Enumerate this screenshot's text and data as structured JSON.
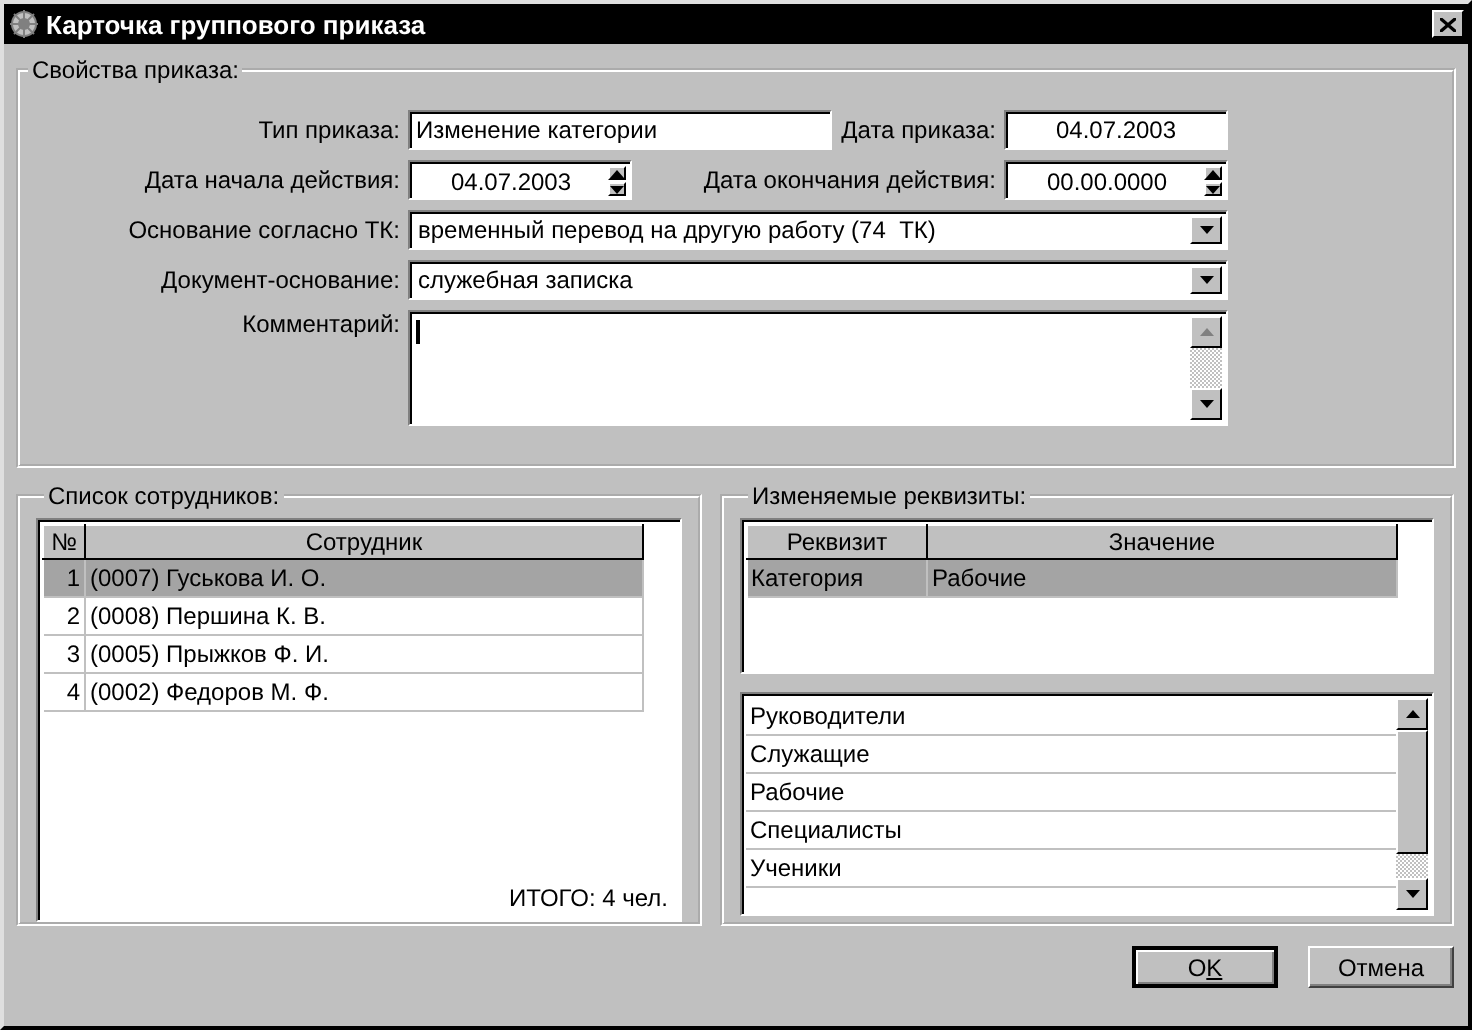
{
  "window": {
    "title": "Карточка группового приказа"
  },
  "order_properties": {
    "title": "Свойства приказа:",
    "order_type": {
      "label": "Тип приказа:",
      "value": "Изменение категории"
    },
    "order_date": {
      "label": "Дата приказа:",
      "value": "04.07.2003"
    },
    "start_date": {
      "label": "Дата начала действия:",
      "value": "04.07.2003"
    },
    "end_date": {
      "label": "Дата окончания действия:",
      "value": "00.00.0000"
    },
    "basis_tk": {
      "label": "Основание согласно ТК:",
      "value": "временный перевод на другую работу (74  ТК)"
    },
    "basis_document": {
      "label": "Документ-основание:",
      "value": "служебная записка"
    },
    "comment": {
      "label": "Комментарий:"
    }
  },
  "employees": {
    "title": "Список сотрудников:",
    "columns": [
      "№",
      "Сотрудник"
    ],
    "rows": [
      {
        "number": "1",
        "name": "(0007) Гуськова И. О.",
        "selected": true
      },
      {
        "number": "2",
        "name": "(0008) Першина К. В.",
        "selected": false
      },
      {
        "number": "3",
        "name": "(0005) Прыжков Ф. И.",
        "selected": false
      },
      {
        "number": "4",
        "name": "(0002) Федоров М. Ф.",
        "selected": false
      }
    ],
    "total": "ИТОГО: 4 чел."
  },
  "attributes": {
    "title": "Изменяемые реквизиты:",
    "columns": [
      "Реквизит",
      "Значение"
    ],
    "rows": [
      {
        "attribute": "Категория",
        "value": "Рабочие",
        "selected": true
      }
    ],
    "options": [
      {
        "label": "Руководители",
        "selected": false
      },
      {
        "label": "Служащие",
        "selected": false
      },
      {
        "label": "Рабочие",
        "selected": false
      },
      {
        "label": "Специалисты",
        "selected": false
      },
      {
        "label": "Ученики",
        "selected": false
      }
    ]
  },
  "buttons": [
    {
      "label": "O",
      "mnemonic": "K",
      "default": true
    },
    {
      "label": "Отмена",
      "default": false
    }
  ]
}
